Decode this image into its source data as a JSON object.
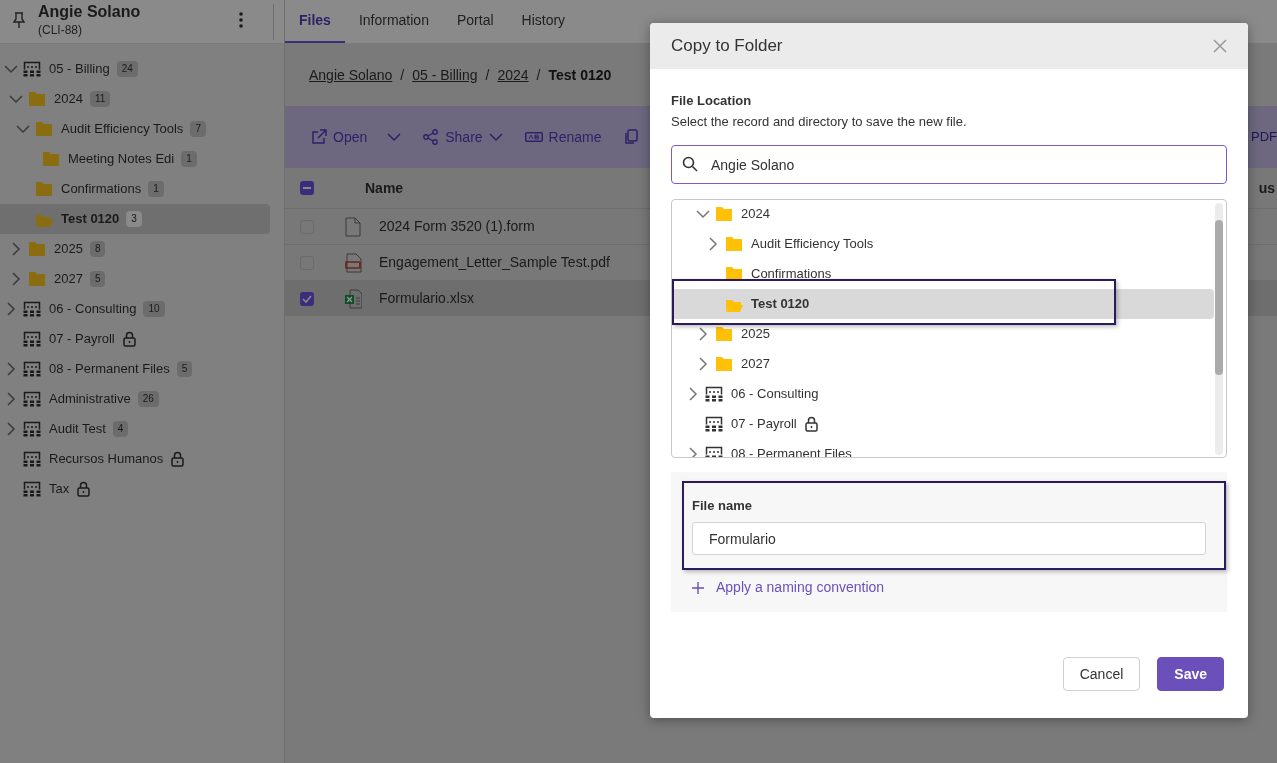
{
  "sidebar": {
    "title": "Angie Solano",
    "subtitle": "(CLI-88)",
    "tree": [
      {
        "label": "05 - Billing",
        "kind": "cabinet",
        "count": "24",
        "expanded": true,
        "locked": false,
        "selected": false,
        "children": [
          {
            "label": "2024",
            "kind": "folder",
            "count": "11",
            "expanded": true,
            "locked": false,
            "selected": false,
            "children": [
              {
                "label": "Audit Efficiency Tools",
                "kind": "folder",
                "count": "7",
                "expanded": true,
                "locked": false,
                "selected": false,
                "children": [
                  {
                    "label": "Meeting Notes Edi",
                    "kind": "folder",
                    "count": "1",
                    "locked": false,
                    "selected": false
                  }
                ]
              },
              {
                "label": "Confirmations",
                "kind": "folder",
                "count": "1",
                "locked": false,
                "selected": false
              },
              {
                "label": "Test 0120",
                "kind": "folder",
                "count": "3",
                "locked": false,
                "selected": true
              }
            ]
          },
          {
            "label": "2025",
            "kind": "folder",
            "count": "8",
            "expanded": false,
            "locked": false,
            "selected": false
          },
          {
            "label": "2027",
            "kind": "folder",
            "count": "5",
            "expanded": false,
            "locked": false,
            "selected": false
          }
        ]
      },
      {
        "label": "06 - Consulting",
        "kind": "cabinet",
        "count": "10",
        "expanded": false,
        "locked": false,
        "selected": false
      },
      {
        "label": "07 - Payroll",
        "kind": "cabinet",
        "locked": true,
        "selected": false
      },
      {
        "label": "08 - Permanent Files",
        "kind": "cabinet",
        "count": "5",
        "expanded": false,
        "locked": false,
        "selected": false
      },
      {
        "label": "Administrative",
        "kind": "cabinet",
        "count": "26",
        "expanded": false,
        "locked": false,
        "selected": false
      },
      {
        "label": "Audit Test",
        "kind": "cabinet",
        "count": "4",
        "expanded": false,
        "locked": false,
        "selected": false
      },
      {
        "label": "Recursos Humanos",
        "kind": "cabinet",
        "locked": true,
        "selected": false
      },
      {
        "label": "Tax",
        "kind": "cabinet",
        "locked": true,
        "selected": false
      }
    ]
  },
  "tabs": [
    {
      "label": "Files",
      "selected": true
    },
    {
      "label": "Information",
      "selected": false
    },
    {
      "label": "Portal",
      "selected": false
    },
    {
      "label": "History",
      "selected": false
    }
  ],
  "breadcrumb": [
    {
      "label": "Angie Solano",
      "current": false
    },
    {
      "separator": "/",
      "label": "05 - Billing",
      "current": false
    },
    {
      "separator": "/",
      "label": "2024",
      "current": false
    },
    {
      "separator": "/",
      "label": "Test 0120",
      "current": true
    }
  ],
  "toolbar": {
    "buttons": [
      {
        "label": "Open",
        "dropdown": true
      },
      {
        "label": "Share",
        "dropdown": true
      },
      {
        "label": "Rename",
        "dropdown": false
      }
    ],
    "trailing_label": "PDF"
  },
  "table": {
    "select_all": {
      "indeterminate": true
    },
    "columns": [
      "Name",
      "us"
    ],
    "rows": [
      {
        "name": "2024 Form 3520 (1).form",
        "kind": "form",
        "checked": false
      },
      {
        "name": "Engagement_Letter_Sample Test.pdf",
        "kind": "pdf",
        "checked": false
      },
      {
        "name": "Formulario.xlsx",
        "kind": "xlsx",
        "checked": true
      }
    ]
  },
  "dialog": {
    "title": "Copy to Folder",
    "section_title": "File Location",
    "description": "Select the record and directory to save the new file.",
    "search": {
      "value": "Angie Solano"
    },
    "tree": [
      {
        "kind": "hidden",
        "children": [
          {
            "label": "2024",
            "kind": "folder",
            "expanded": true,
            "locked": false,
            "selected": false,
            "children": [
              {
                "label": "Audit Efficiency Tools",
                "kind": "folder",
                "expanded": false,
                "locked": false,
                "selected": false
              },
              {
                "label": "Confirmations",
                "kind": "folder",
                "locked": false,
                "selected": false
              },
              {
                "label": "Test 0120",
                "kind": "folder",
                "locked": false,
                "selected": true
              }
            ]
          },
          {
            "label": "2025",
            "kind": "folder",
            "expanded": false,
            "locked": false,
            "selected": false
          },
          {
            "label": "2027",
            "kind": "folder",
            "expanded": false,
            "locked": false,
            "selected": false
          }
        ]
      },
      {
        "label": "06 - Consulting",
        "kind": "cabinet",
        "expanded": false,
        "locked": false,
        "selected": false
      },
      {
        "label": "07 - Payroll",
        "kind": "cabinet",
        "locked": true,
        "selected": false
      },
      {
        "label": "08 - Permanent Files",
        "kind": "cabinet",
        "expanded": false,
        "locked": false,
        "selected": false
      }
    ],
    "file_name": {
      "label": "File name",
      "value": "Formulario"
    },
    "link": "Apply a naming convention",
    "buttons": [
      {
        "label": "Cancel",
        "kind": "secondary"
      },
      {
        "label": "Save",
        "kind": "primary"
      }
    ]
  }
}
